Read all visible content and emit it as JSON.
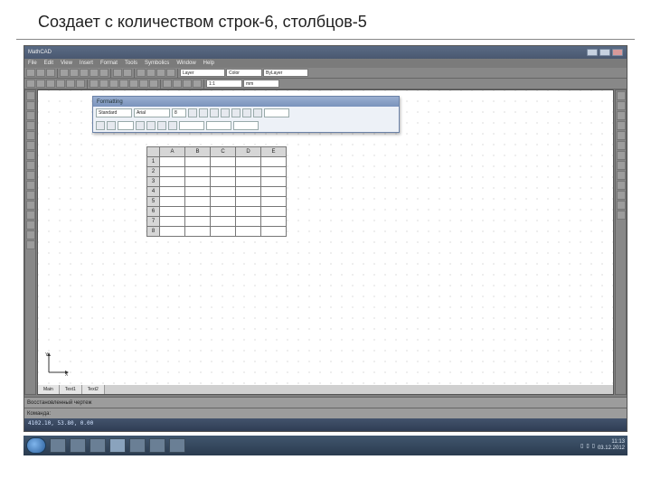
{
  "slide": {
    "caption": "Создает с количеством строк-6, столбцов-5"
  },
  "app": {
    "title": "MathCAD",
    "menu": [
      "File",
      "Edit",
      "View",
      "Insert",
      "Format",
      "Tools",
      "Symbolics",
      "Window",
      "Help"
    ],
    "floating": {
      "title": "Formatting",
      "style": "Standard",
      "font": "Arial",
      "size": "8"
    },
    "table": {
      "cols": [
        "A",
        "B",
        "C",
        "D",
        "E"
      ],
      "rows": [
        "1",
        "2",
        "3",
        "4",
        "5",
        "6",
        "7",
        "8"
      ]
    },
    "tabs": [
      "Main",
      "Text1",
      "Text2"
    ],
    "status": {
      "line1": "Восстановленный чертеж",
      "line2": "Команда:"
    },
    "cmd": "4102.10, 53.80, 0.00"
  },
  "taskbar": {
    "apps": [
      "explorer",
      "browser",
      "folder",
      "mathcad",
      "media",
      "pdf",
      "doc"
    ],
    "clock": {
      "time": "11:13",
      "date": "03.12.2012"
    }
  }
}
